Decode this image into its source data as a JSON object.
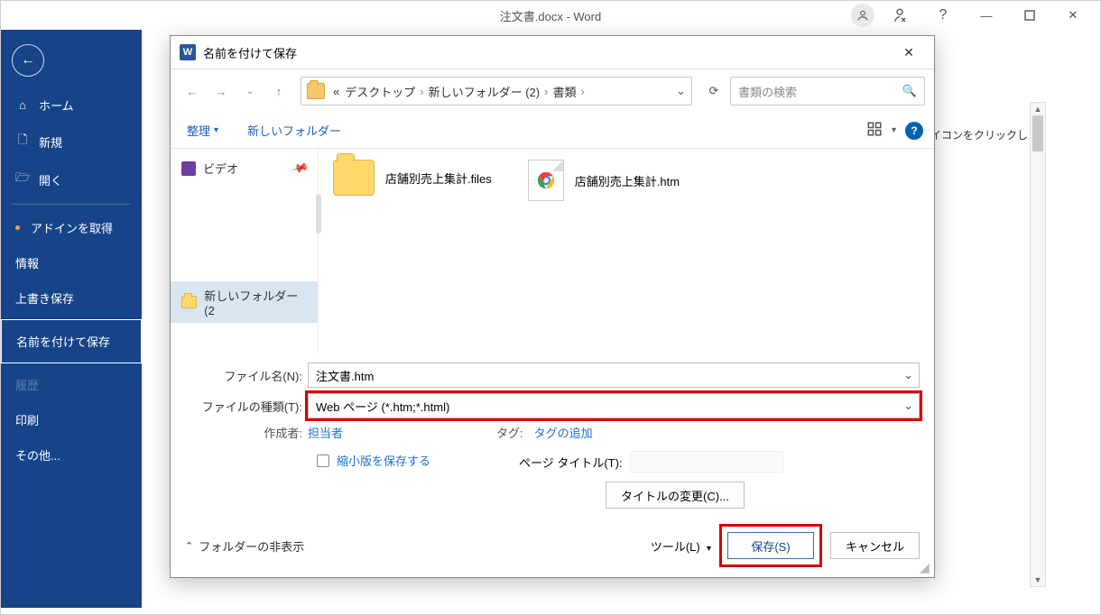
{
  "window": {
    "title": "注文書.docx  -  Word"
  },
  "sidebar": {
    "home": "ホーム",
    "new": "新規",
    "open": "開く",
    "getaddin": "アドインを取得",
    "info": "情報",
    "overwrite": "上書き保存",
    "saveas": "名前を付けて保存",
    "history": "履歴",
    "print": "印刷",
    "other": "その他..."
  },
  "hint": "イコンをクリックしま",
  "dialog": {
    "title": "名前を付けて保存",
    "breadcrumb": {
      "prefix": "«",
      "p1": "デスクトップ",
      "p2": "新しいフォルダー (2)",
      "p3": "書類"
    },
    "search_placeholder": "書類の検索",
    "toolbar": {
      "organize": "整理",
      "newfolder": "新しいフォルダー"
    },
    "tree": {
      "video": "ビデオ",
      "newfolder": "新しいフォルダー (2"
    },
    "files": {
      "f1": "店舗別売上集計.files",
      "f2": "店舗別売上集計.htm"
    },
    "filename_label": "ファイル名(N):",
    "filename_value": "注文書.htm",
    "filetype_label": "ファイルの種類(T):",
    "filetype_value": "Web ページ (*.htm;*.html)",
    "author_label": "作成者:",
    "author_value": "担当者",
    "tag_label": "タグ:",
    "tag_value": "タグの追加",
    "thumb_label": "縮小版を保存する",
    "pagetitle_label": "ページ タイトル(T):",
    "titlechange": "タイトルの変更(C)...",
    "hidefolders": "フォルダーの非表示",
    "tools": "ツール(L)",
    "save": "保存(S)",
    "cancel": "キャンセル"
  }
}
